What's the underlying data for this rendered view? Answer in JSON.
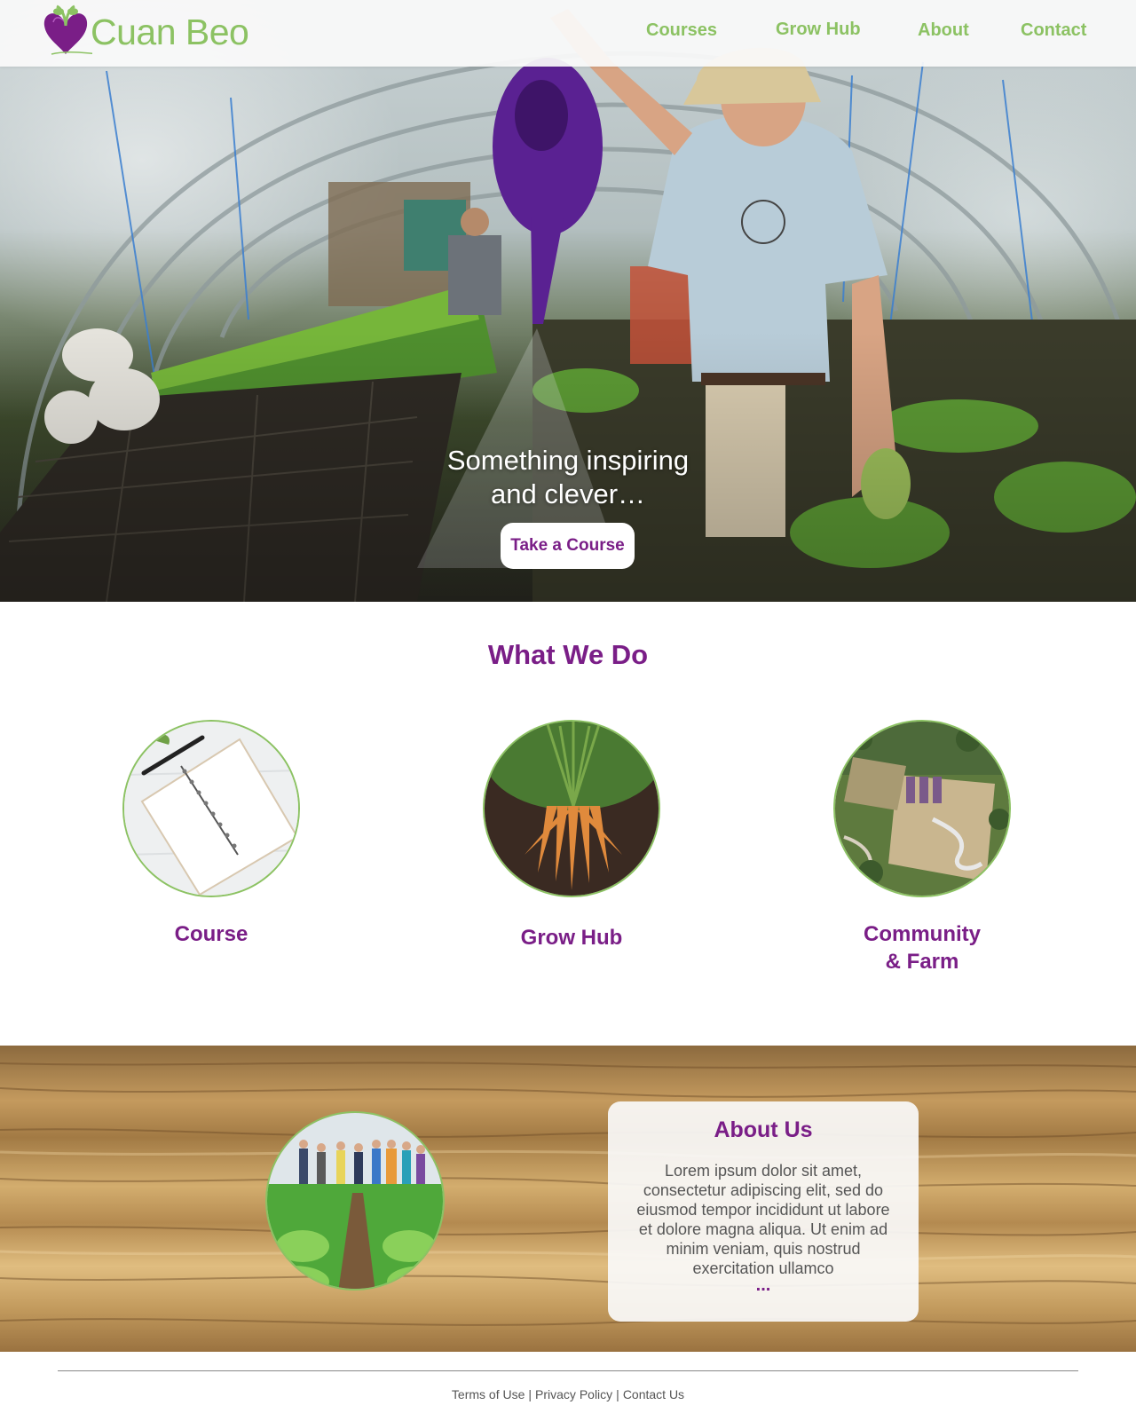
{
  "brand": {
    "name": "Cuan Beo",
    "colors": {
      "purple": "#7a1e87",
      "green": "#8cc263"
    },
    "logo_icon": "beetroot-heart-icon"
  },
  "nav": {
    "items": [
      {
        "label": "Courses"
      },
      {
        "label": "Grow Hub"
      },
      {
        "label": "About"
      },
      {
        "label": "Contact"
      }
    ]
  },
  "hero": {
    "image": "greenhouse-watering-photo",
    "headline_line1": "Something inspiring",
    "headline_line2": "and clever…",
    "cta_label": "Take a Course"
  },
  "what_we_do": {
    "title": "What We Do",
    "items": [
      {
        "label": "Course",
        "image": "notebook-photo"
      },
      {
        "label": "Grow Hub",
        "image": "carrots-photo"
      },
      {
        "label_line1": "Community",
        "label_line2": "& Farm",
        "image": "aerial-farm-photo"
      }
    ]
  },
  "about": {
    "title": "About Us",
    "body": "Lorem ipsum dolor sit amet, consectetur adipiscing elit, sed do eiusmod tempor incididunt ut labore et dolore magna aliqua. Ut enim ad minim veniam, quis nostrud exercitation ullamco",
    "more": "...",
    "image": "group-in-field-photo"
  },
  "footer": {
    "links": [
      {
        "label": "Terms of Use"
      },
      {
        "label": "Privacy Policy"
      },
      {
        "label": "Contact Us"
      }
    ],
    "separator": "|"
  }
}
